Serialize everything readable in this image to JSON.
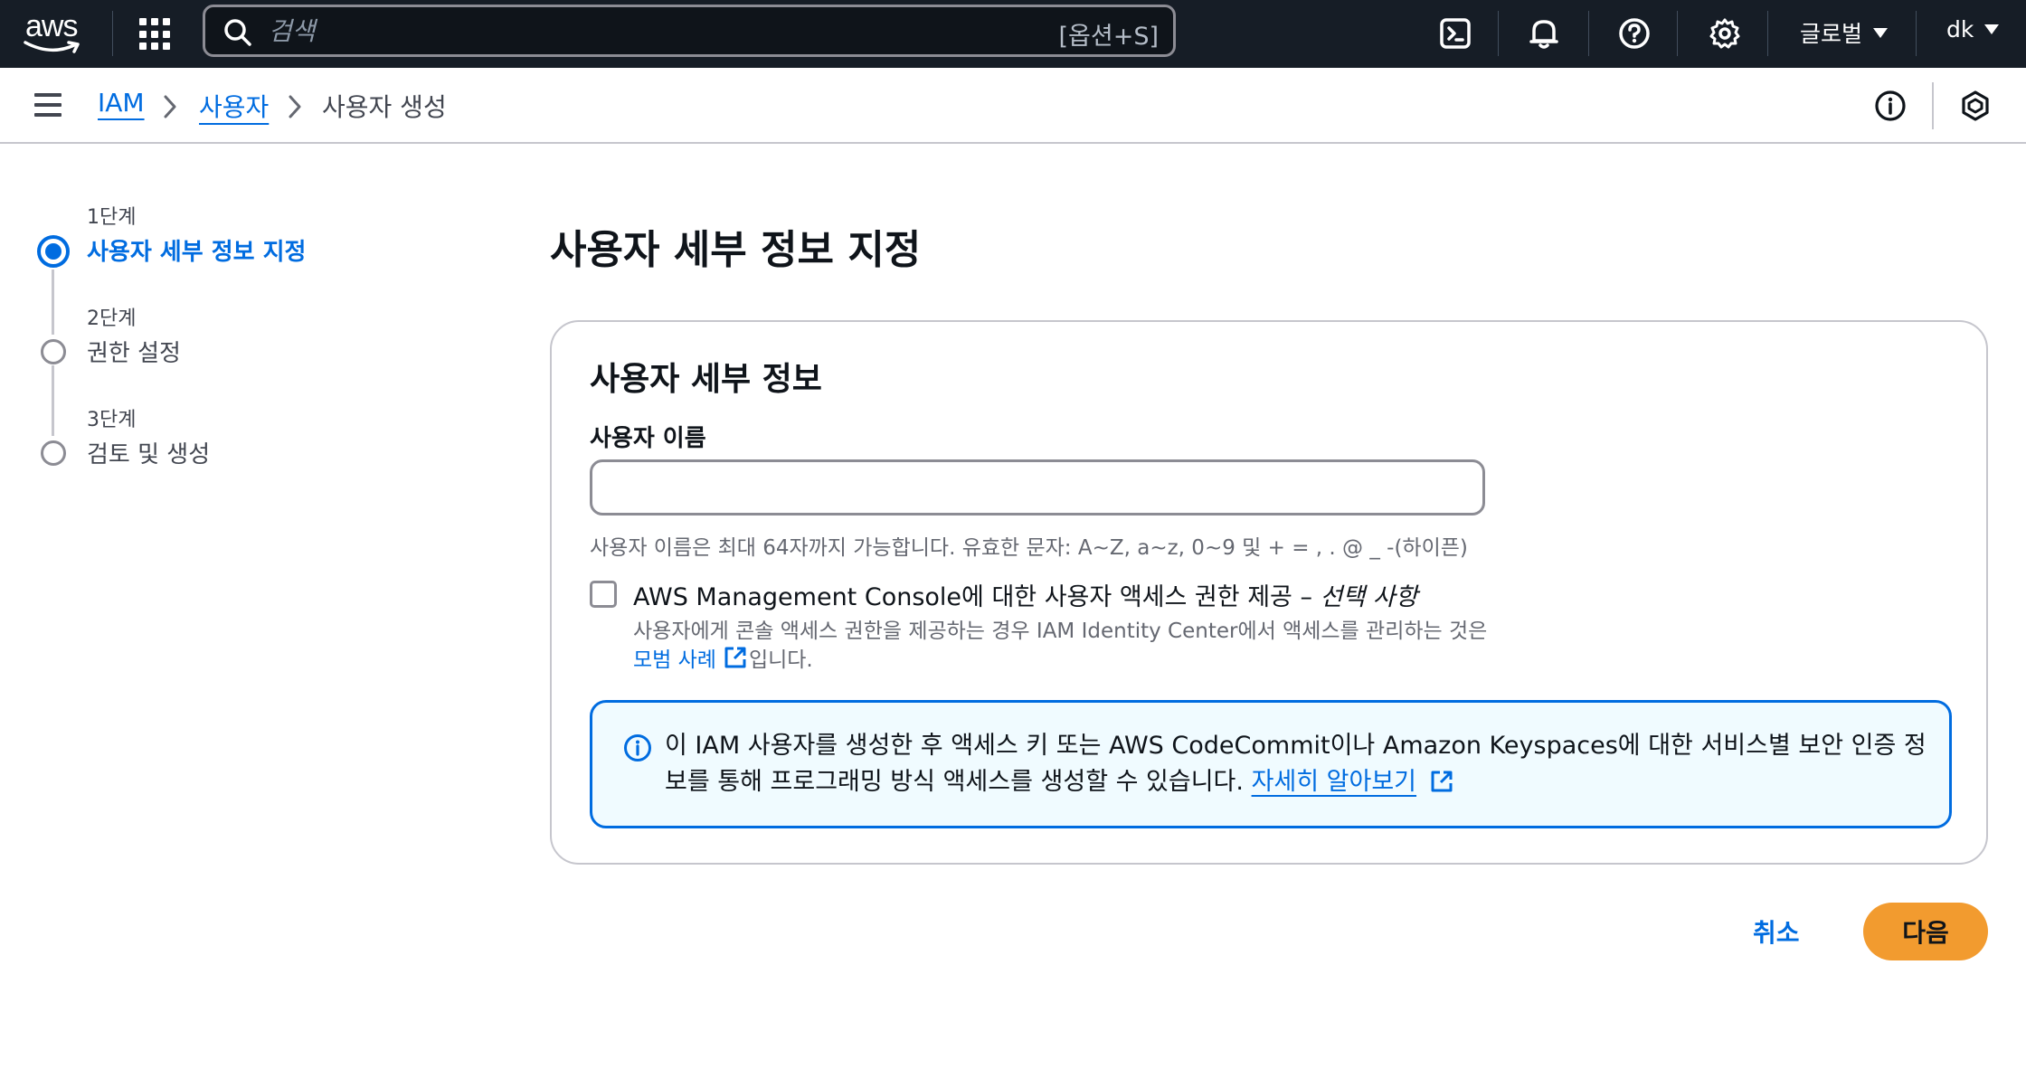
{
  "topnav": {
    "logo_text": "aws",
    "search_placeholder": "검색",
    "search_shortcut": "[옵션+S]",
    "region_label": "글로벌",
    "account_label": "dk"
  },
  "breadcrumb": {
    "items": [
      "IAM",
      "사용자",
      "사용자 생성"
    ]
  },
  "wizard": {
    "steps": [
      {
        "label": "1단계",
        "title": "사용자 세부 정보 지정",
        "active": true
      },
      {
        "label": "2단계",
        "title": "권한 설정",
        "active": false
      },
      {
        "label": "3단계",
        "title": "검토 및 생성",
        "active": false
      }
    ]
  },
  "main": {
    "page_title": "사용자 세부 정보 지정",
    "card_title": "사용자 세부 정보",
    "username_label": "사용자 이름",
    "username_value": "",
    "username_hint": "사용자 이름은 최대 64자까지 가능합니다. 유효한 문자: A~Z, a~z, 0~9 및 + = , . @ _ -(하이픈)",
    "console_access_label": "AWS Management Console에 대한 사용자 액세스 권한 제공 – ",
    "console_access_optional": "선택 사항",
    "console_access_desc": "사용자에게 콘솔 액세스 권한을 제공하는 경우 IAM Identity Center에서 액세스를 관리하는 것은",
    "best_practice_link": "모범 사례",
    "best_practice_suffix": "입니다.",
    "info_text": "이 IAM 사용자를 생성한 후 액세스 키 또는 AWS CodeCommit이나 Amazon Keyspaces에 대한 서비스별 보안 인증 정보를 통해 프로그래밍 방식 액세스를 생성할 수 있습니다. ",
    "learn_more_link": "자세히 알아보기"
  },
  "actions": {
    "cancel_label": "취소",
    "next_label": "다음"
  }
}
